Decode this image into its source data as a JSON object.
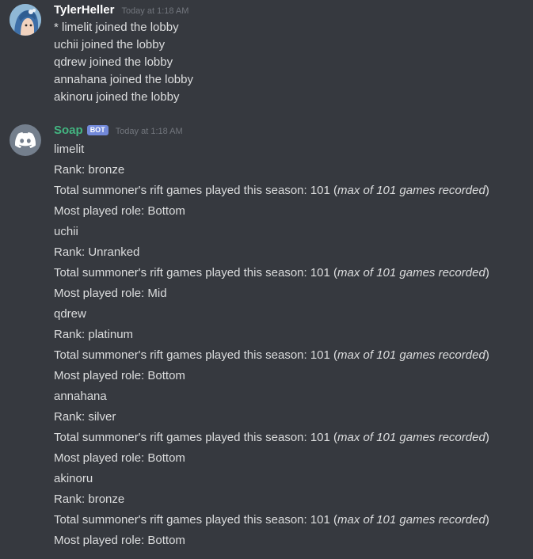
{
  "messages": [
    {
      "author": "TylerHeller",
      "timestamp": "Today at 1:18 AM",
      "lines": [
        "* limelit joined the lobby",
        "uchii joined the lobby",
        "qdrew joined the lobby",
        "annahana joined the lobby",
        "akinoru joined the lobby"
      ]
    },
    {
      "author": "Soap",
      "bot_tag": "BOT",
      "timestamp": "Today at 1:18 AM",
      "players": [
        {
          "name": "limelit",
          "rank": "Rank: bronze",
          "games_prefix": "Total summoner's rift games played this season: 101 (",
          "games_italic": "max of 101 games recorded",
          "games_suffix": ")",
          "role": "Most played role: Bottom"
        },
        {
          "name": "uchii",
          "rank": "Rank: Unranked",
          "games_prefix": "Total summoner's rift games played this season: 101 (",
          "games_italic": "max of 101 games recorded",
          "games_suffix": ")",
          "role": "Most played role: Mid"
        },
        {
          "name": "qdrew",
          "rank": "Rank: platinum",
          "games_prefix": "Total summoner's rift games played this season: 101 (",
          "games_italic": "max of 101 games recorded",
          "games_suffix": ")",
          "role": "Most played role: Bottom"
        },
        {
          "name": "annahana",
          "rank": "Rank: silver",
          "games_prefix": "Total summoner's rift games played this season: 101 (",
          "games_italic": "max of 101 games recorded",
          "games_suffix": ")",
          "role": "Most played role: Bottom"
        },
        {
          "name": "akinoru",
          "rank": "Rank: bronze",
          "games_prefix": "Total summoner's rift games played this season: 101 (",
          "games_italic": "max of 101 games recorded",
          "games_suffix": ")",
          "role": "Most played role: Bottom"
        }
      ]
    }
  ],
  "colors": {
    "background": "#36393f",
    "text": "#dcddde",
    "username": "#ffffff",
    "bot_username": "#43b581",
    "bot_tag": "#7289da",
    "timestamp": "#72767d"
  },
  "icons": {
    "user_avatar": "anime-girl-avatar",
    "bot_avatar": "discord-logo-icon"
  }
}
